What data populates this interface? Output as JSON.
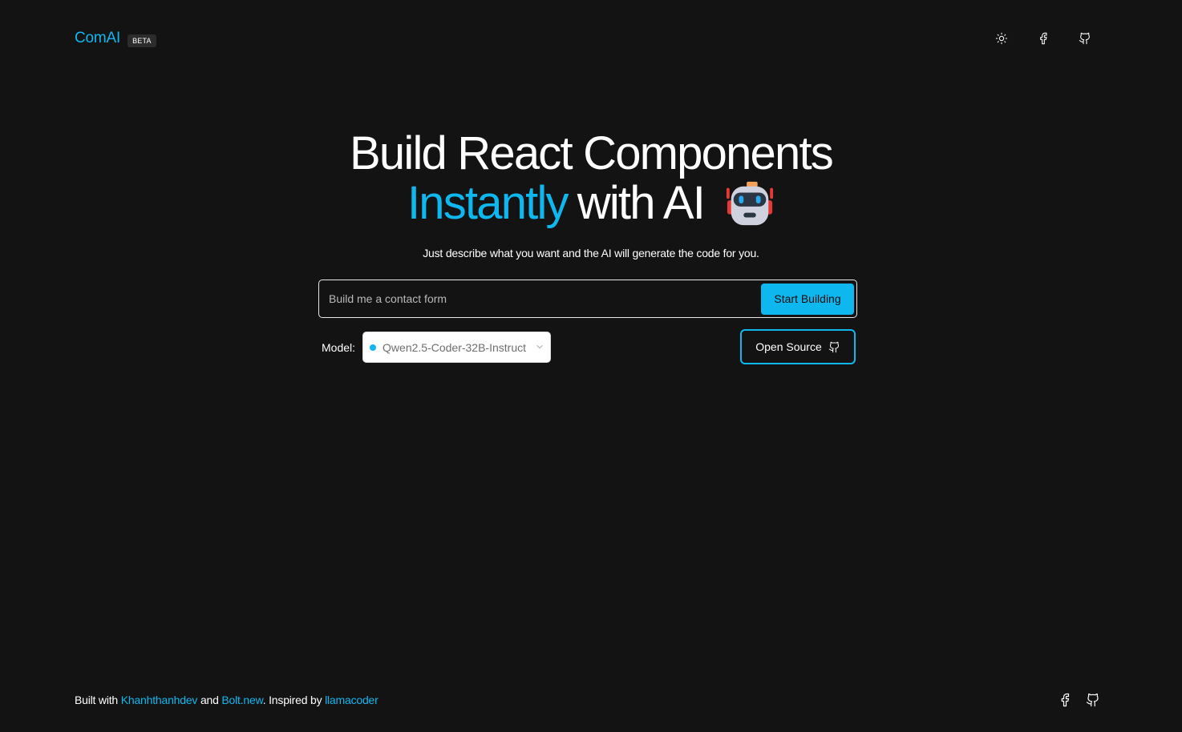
{
  "header": {
    "logo": "ComAI",
    "badge": "BETA",
    "icons": [
      "sun-icon",
      "facebook-icon",
      "github-icon"
    ]
  },
  "hero": {
    "line1": "Build React Components",
    "accent_word": "Instantly",
    "line2_rest": "with AI",
    "emoji_icon": "robot-icon",
    "subtitle": "Just describe what you want and the AI will generate the code for you."
  },
  "search": {
    "placeholder": "Build me a contact form",
    "value": "",
    "button_label": "Start Building"
  },
  "model": {
    "label": "Model:",
    "selected": "Qwen2.5-Coder-32B-Instruct"
  },
  "open_source": {
    "label": "Open Source"
  },
  "footer": {
    "prefix": "Built with",
    "link1": "Khanhthanhdev",
    "connector": "and",
    "link2": "Bolt.new",
    "mid": ". Inspired by",
    "link3": "llamacoder",
    "icons": [
      "facebook-icon",
      "github-icon"
    ]
  },
  "colors": {
    "background": "#141314",
    "accent": "#0fb7ef",
    "text": "#ffffff"
  }
}
